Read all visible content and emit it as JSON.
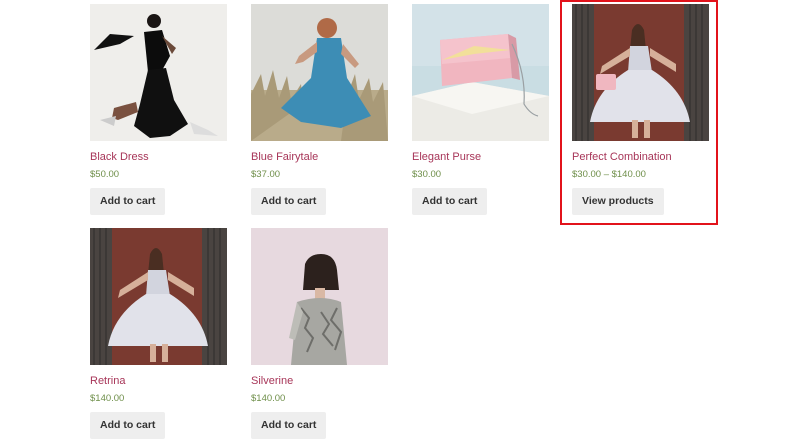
{
  "products": [
    {
      "name": "Black Dress",
      "price": "$50.00",
      "button": "Add to cart",
      "image": "woman-in-black-dress"
    },
    {
      "name": "Blue Fairytale",
      "price": "$37.00",
      "button": "Add to cart",
      "image": "woman-in-blue-dress-field"
    },
    {
      "name": "Elegant Purse",
      "price": "$30.00",
      "button": "Add to cart",
      "image": "pink-purse"
    },
    {
      "name": "Perfect Combination",
      "price": "$30.00 – $140.00",
      "button": "View products",
      "image": "woman-white-dress-red-wall"
    },
    {
      "name": "Retrina",
      "price": "$140.00",
      "button": "Add to cart",
      "image": "woman-white-dress-red-wall"
    },
    {
      "name": "Silverine",
      "price": "$140.00",
      "button": "Add to cart",
      "image": "woman-silver-top"
    }
  ],
  "colors": {
    "product_name": "#a73558",
    "price": "#6f8f4a",
    "button_bg": "#eeeeee",
    "highlight_border": "#e2131b"
  }
}
